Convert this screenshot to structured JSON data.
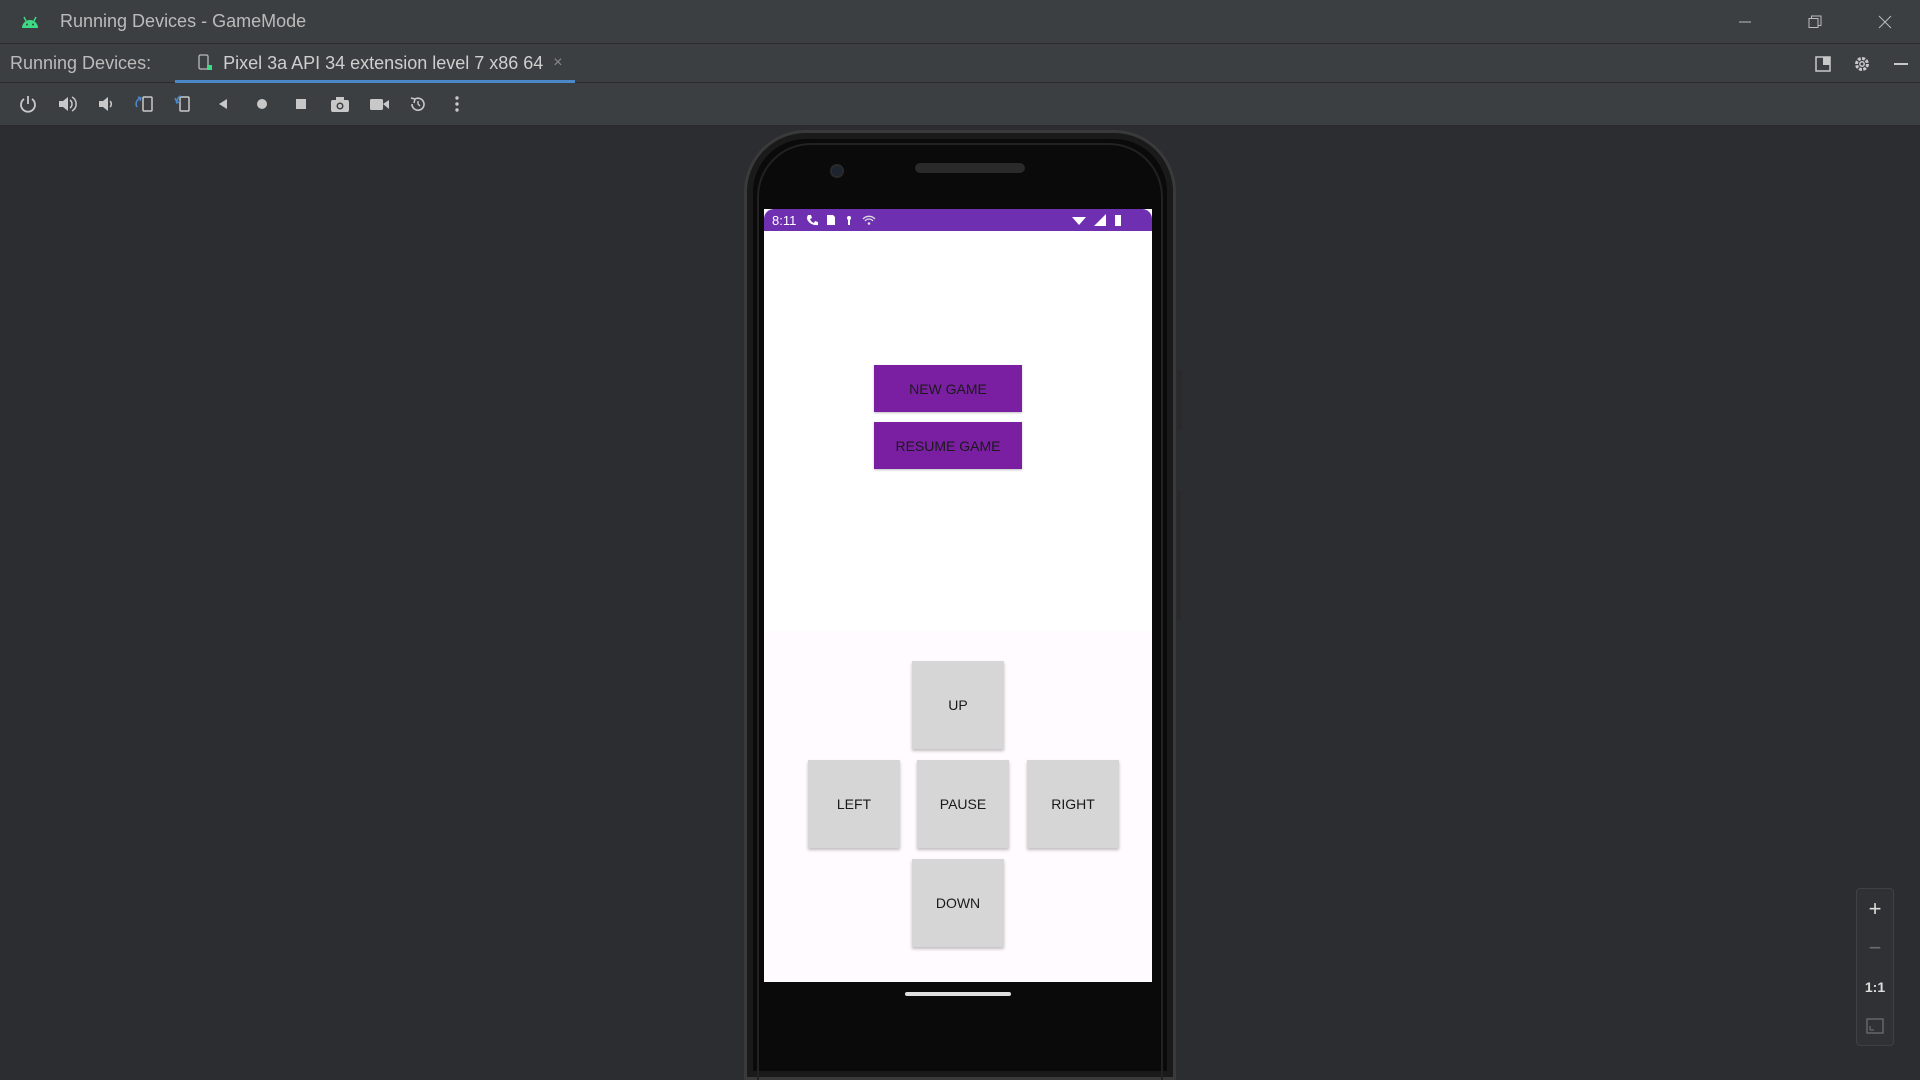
{
  "window": {
    "title": "Running Devices - GameMode"
  },
  "tabbar": {
    "label": "Running Devices:",
    "tab_label": "Pixel 3a API 34 extension level 7 x86 64",
    "close_glyph": "×"
  },
  "toolbar": {
    "icons": [
      "power-icon",
      "volume-up-icon",
      "volume-down-icon",
      "rotate-left-icon",
      "rotate-right-icon",
      "back-icon",
      "home-icon",
      "overview-icon",
      "screenshot-icon",
      "screen-record-icon",
      "reset-icon",
      "more-icon"
    ]
  },
  "device": {
    "status_time": "8:11",
    "status_bar_color": "#6e2fb0"
  },
  "app": {
    "new_game": "NEW GAME",
    "resume_game": "RESUME GAME",
    "up": "UP",
    "left": "LEFT",
    "pause": "PAUSE",
    "right": "RIGHT",
    "down": "DOWN",
    "button_color": "#7b1fa2"
  },
  "zoom": {
    "zoom_in": "+",
    "zoom_out": "−",
    "actual_size": "1:1"
  },
  "colors": {
    "accent": "#4a88c7",
    "android_green": "#3ddc84"
  }
}
